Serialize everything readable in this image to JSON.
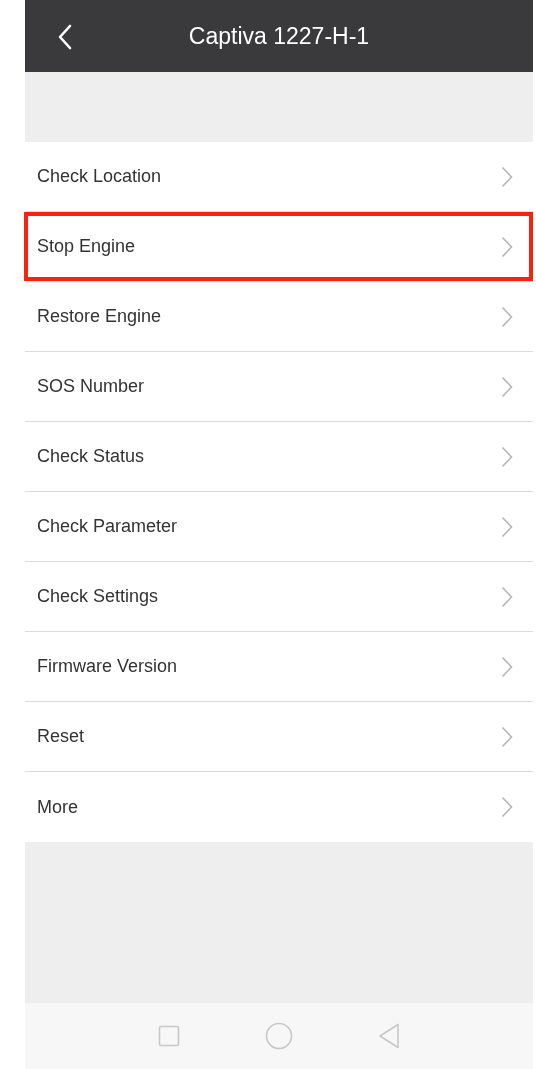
{
  "header": {
    "title": "Captiva 1227-H-1"
  },
  "items": [
    {
      "label": "Check Location",
      "highlighted": false
    },
    {
      "label": "Stop Engine",
      "highlighted": true
    },
    {
      "label": "Restore Engine",
      "highlighted": false
    },
    {
      "label": "SOS Number",
      "highlighted": false
    },
    {
      "label": "Check Status",
      "highlighted": false
    },
    {
      "label": "Check Parameter",
      "highlighted": false
    },
    {
      "label": "Check Settings",
      "highlighted": false
    },
    {
      "label": "Firmware Version",
      "highlighted": false
    },
    {
      "label": "Reset",
      "highlighted": false
    },
    {
      "label": "More",
      "highlighted": false
    }
  ]
}
